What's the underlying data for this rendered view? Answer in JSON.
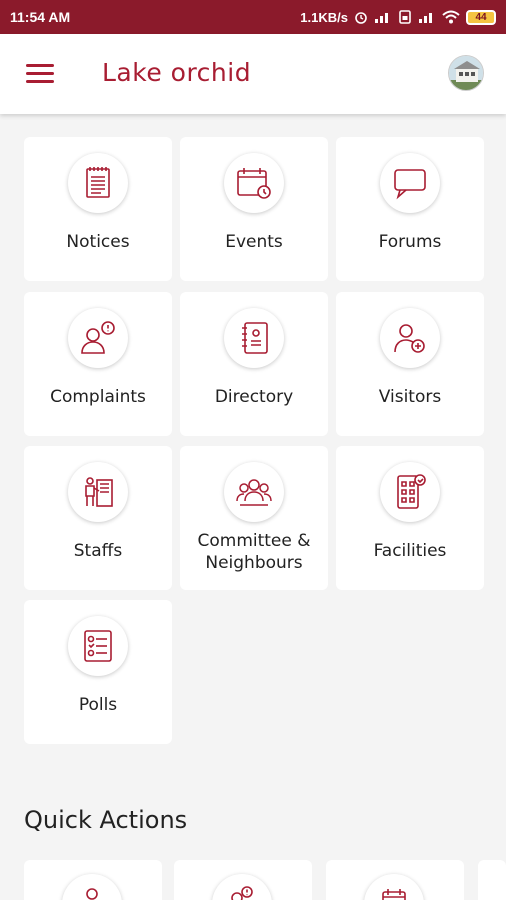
{
  "status_bar": {
    "time": "11:54 AM",
    "speed": "1.1KB/s",
    "battery": "44"
  },
  "app_bar": {
    "title": "Lake orchid"
  },
  "colors": {
    "accent": "#a81d32",
    "status_bar": "#8b1a2b"
  },
  "modules": [
    {
      "label": "Notices",
      "icon": "notices-icon"
    },
    {
      "label": "Events",
      "icon": "events-calendar-icon"
    },
    {
      "label": "Forums",
      "icon": "forums-chat-icon"
    },
    {
      "label": "Complaints",
      "icon": "complaints-icon"
    },
    {
      "label": "Directory",
      "icon": "directory-book-icon"
    },
    {
      "label": "Visitors",
      "icon": "visitors-add-user-icon"
    },
    {
      "label": "Staffs",
      "icon": "staffs-icon"
    },
    {
      "label": "Committee & Neighbours",
      "label_line1": "Committee &",
      "label_line2": "Neighbours",
      "icon": "committee-group-icon"
    },
    {
      "label": "Facilities",
      "icon": "facilities-building-icon"
    },
    {
      "label": "Polls",
      "icon": "polls-checklist-icon"
    }
  ],
  "quick_actions": {
    "title": "Quick Actions"
  }
}
